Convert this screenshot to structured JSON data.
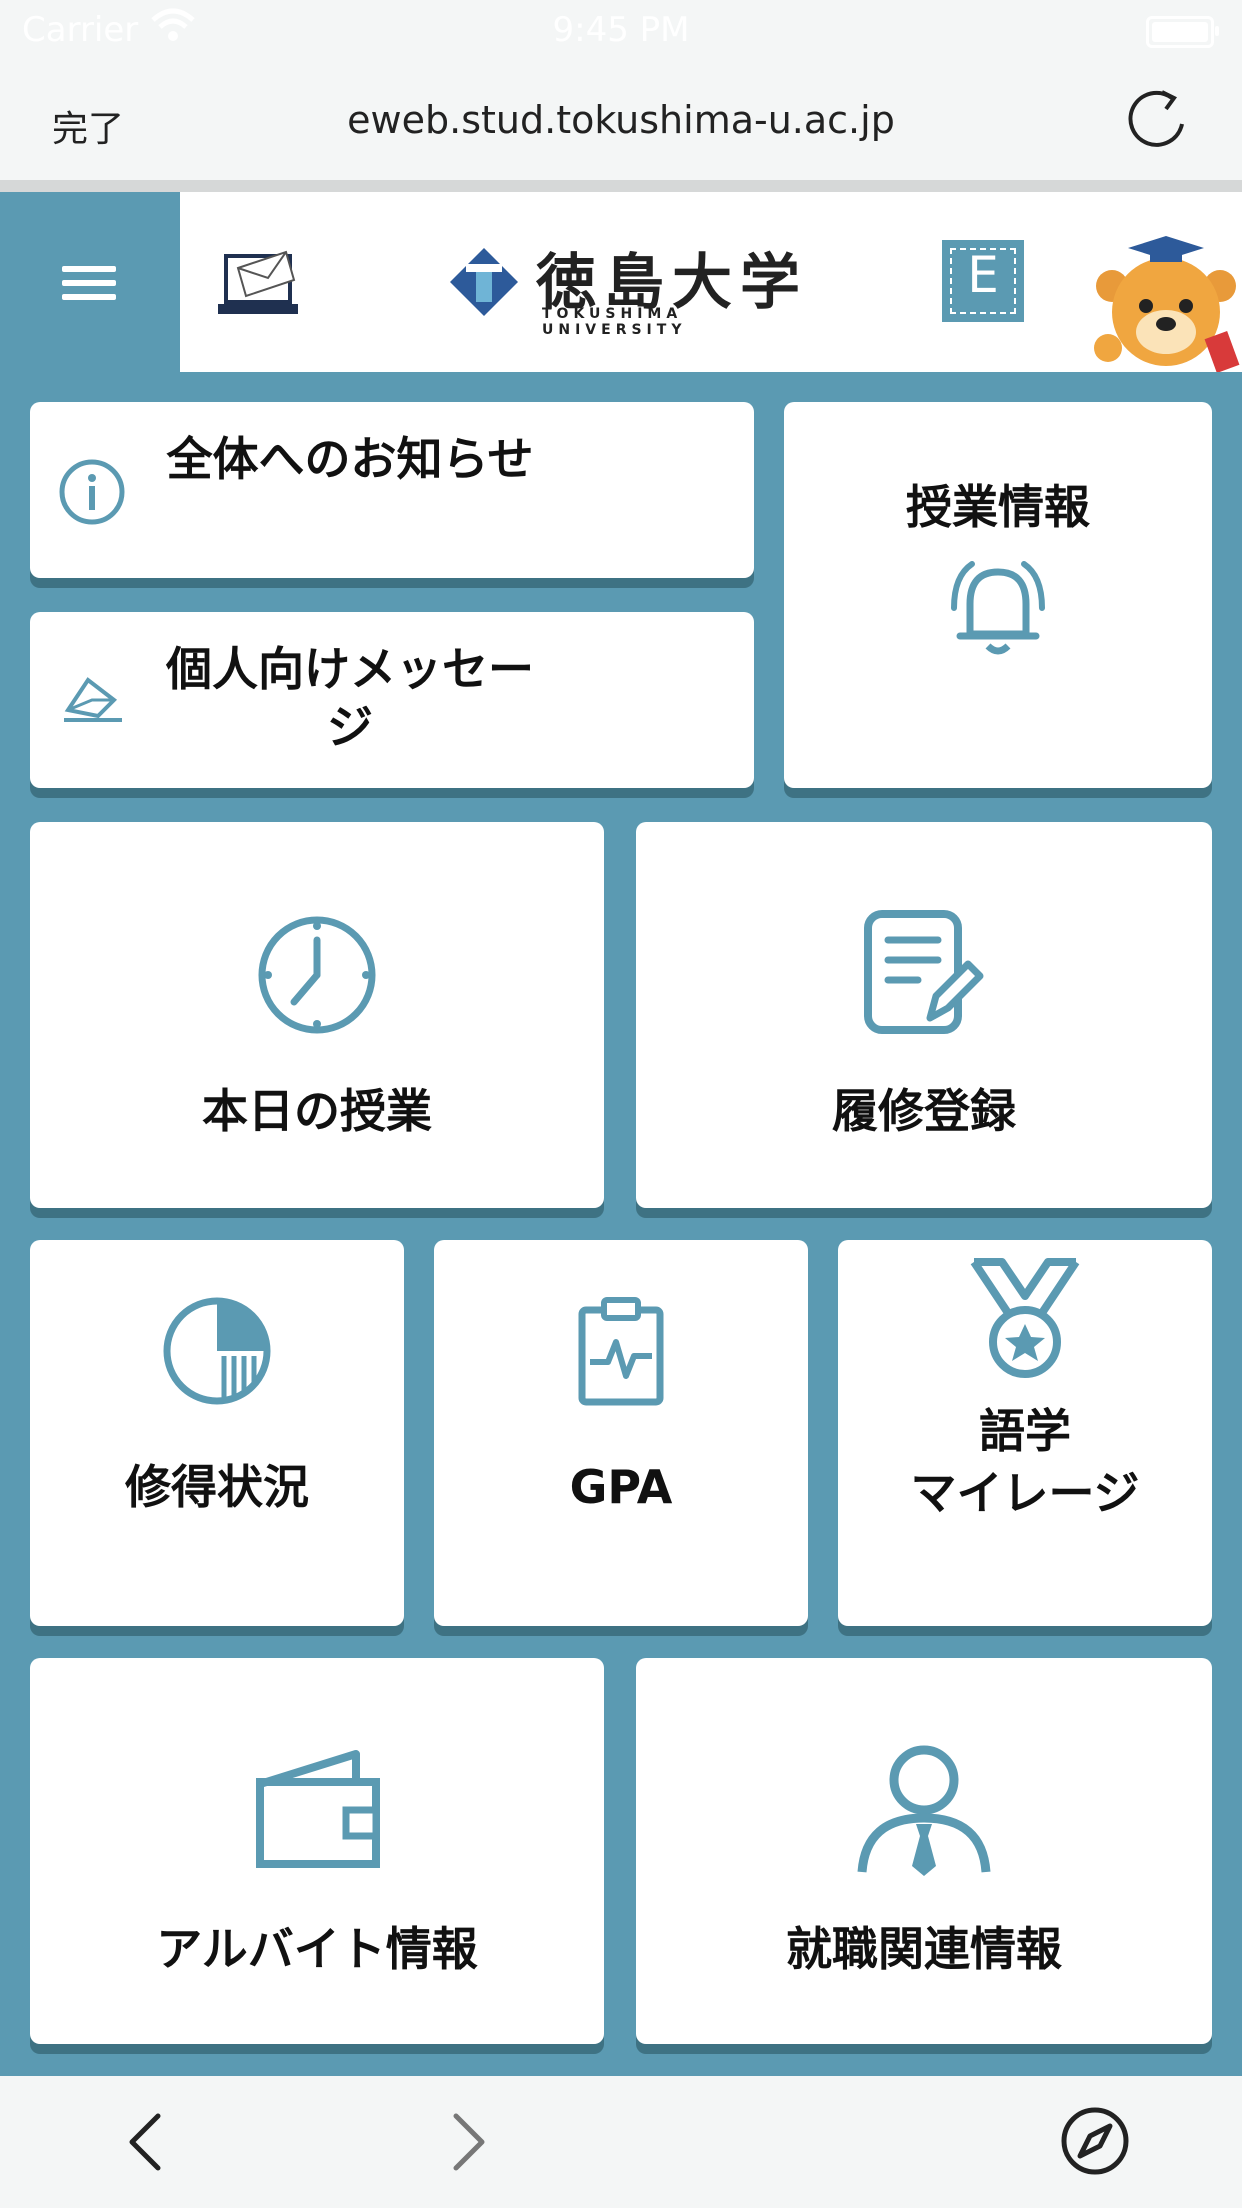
{
  "status_bar": {
    "carrier": "Carrier",
    "time": "9:45 PM"
  },
  "toolbar": {
    "done_label": "完了",
    "url": "eweb.stud.tokushima-u.ac.jp"
  },
  "header": {
    "logo_jp": "徳島大学",
    "logo_en": "TOKUSHIMA UNIVERSITY",
    "e_label": "E"
  },
  "tiles": {
    "announcements": "全体へのお知らせ",
    "personal_messages": "個人向けメッセージ",
    "class_info": "授業情報",
    "today_classes": "本日の授業",
    "course_registration": "履修登録",
    "credits_status": "修得状況",
    "gpa": "GPA",
    "language_mileage_line1": "語学",
    "language_mileage_line2": "マイレージ",
    "part_time_job": "アルバイト情報",
    "career_info": "就職関連情報"
  },
  "colors": {
    "accent": "#5b9ab2",
    "shadow": "#3e7283",
    "tile": "#ffffff"
  }
}
